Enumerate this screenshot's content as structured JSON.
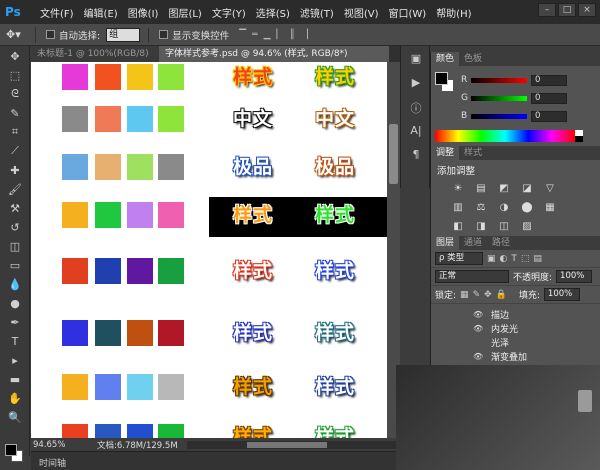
{
  "menubar": {
    "logo": "Ps",
    "items": [
      "文件(F)",
      "编辑(E)",
      "图像(I)",
      "图层(L)",
      "文字(Y)",
      "选择(S)",
      "滤镜(T)",
      "视图(V)",
      "窗口(W)",
      "帮助(H)"
    ],
    "controls": [
      "–",
      "□",
      "×"
    ]
  },
  "options": {
    "auto_select_label": "自动选择:",
    "auto_select_value": "组",
    "show_transform_label": "显示变换控件"
  },
  "tabs": {
    "inactive": "未标题-1 @ 100%(RGB/8)",
    "active": "字体样式参考.psd @ 94.6% (样式, RGB/8*)"
  },
  "canvas": {
    "texts": [
      "样式",
      "样式",
      "中文",
      "中文",
      "极品",
      "极品",
      "样式",
      "样式",
      "样式",
      "样式",
      "样式",
      "样式",
      "样式",
      "样式",
      "样式",
      "样式"
    ]
  },
  "colors": {
    "swatch_rows": [
      [
        "#e63ad8",
        "#f2521f",
        "#f5c418",
        "#8ee43a"
      ],
      [
        "#8a8a8a",
        "#f07a58",
        "#5ec8f0",
        "#8ee43a"
      ],
      [
        "#6aa8e0",
        "#e8b070",
        "#a0e060",
        "#8a8a8a"
      ],
      [
        "#f5b020",
        "#20c840",
        "#c080f0",
        "#f060b0"
      ],
      [
        "#e04020",
        "#2040b0",
        "#6018a0",
        "#18a040"
      ],
      [
        "#3030e0",
        "#205060",
        "#c05010",
        "#b01828"
      ],
      [
        "#f5b020",
        "#6080f0",
        "#70d0f0",
        "#b8b8b8"
      ],
      [
        "#e84020",
        "#2858c0",
        "#2050d0",
        "#18b838"
      ]
    ]
  },
  "status": {
    "zoom": "94.65%",
    "doc": "文档:6.78M/129.5M",
    "timeline": "时间轴"
  },
  "color_panel": {
    "tabs": [
      "颜色",
      "色板"
    ],
    "r_label": "R",
    "g_label": "G",
    "b_label": "B",
    "r_value": "0",
    "g_value": "0",
    "b_value": "0"
  },
  "adjust_panel": {
    "tabs": [
      "调整",
      "样式"
    ],
    "title": "添加调整",
    "icons": [
      "☀",
      "▤",
      "◩",
      "◪",
      "▽",
      "",
      "▥",
      "⚖",
      "◑",
      "⬤",
      "▦",
      "",
      "◧",
      "◨",
      "◫",
      "▨",
      "",
      ""
    ]
  },
  "layers_panel": {
    "tabs": [
      "图层",
      "通道",
      "路径"
    ],
    "kind_label": "ρ 类型",
    "blend_mode": "正常",
    "opacity_label": "不透明度:",
    "opacity_value": "100%",
    "lock_label": "锁定:",
    "fill_label": "填充:",
    "fill_value": "100%",
    "effects": [
      "描边",
      "内发光",
      "光泽",
      "渐变叠加"
    ]
  }
}
